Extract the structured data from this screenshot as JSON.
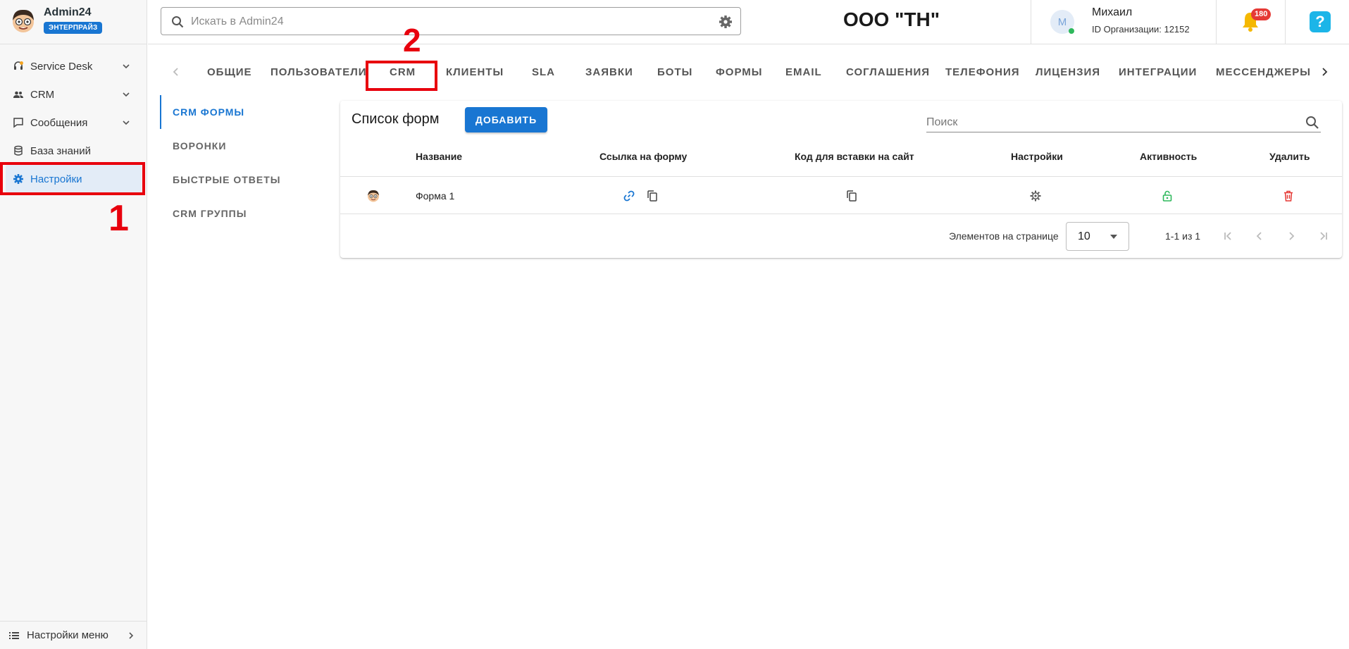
{
  "brand": {
    "name": "Admin24",
    "badge": "ЭНТЕРПРАЙЗ"
  },
  "sidebar": {
    "items": [
      {
        "label": "Service Desk",
        "icon": "headset-icon",
        "has_chevron": true
      },
      {
        "label": "CRM",
        "icon": "people-icon",
        "has_chevron": true
      },
      {
        "label": "Сообщения",
        "icon": "chat-icon",
        "has_chevron": true
      },
      {
        "label": "База знаний",
        "icon": "database-icon",
        "has_chevron": false
      },
      {
        "label": "Настройки",
        "icon": "gear-icon",
        "active": true
      }
    ],
    "menu_settings_label": "Настройки меню"
  },
  "annotations": {
    "marker_1": "1",
    "marker_2": "2"
  },
  "header": {
    "search_placeholder": "Искать в Admin24",
    "org_title": "ООО \"ТН\"",
    "user_initial": "М",
    "user_name": "Михаил",
    "org_id": "ID Организации: 12152",
    "notifications_count": "180",
    "help_label": "?"
  },
  "tabs": [
    {
      "label": "ОБЩИЕ"
    },
    {
      "label": "ПОЛЬЗОВАТЕЛИ"
    },
    {
      "label": "CRM",
      "highlighted": true
    },
    {
      "label": "КЛИЕНТЫ"
    },
    {
      "label": "SLA"
    },
    {
      "label": "ЗАЯВКИ"
    },
    {
      "label": "БОТЫ"
    },
    {
      "label": "ФОРМЫ"
    },
    {
      "label": "EMAIL"
    },
    {
      "label": "СОГЛАШЕНИЯ"
    },
    {
      "label": "ТЕЛЕФОНИЯ"
    },
    {
      "label": "ЛИЦЕНЗИЯ"
    },
    {
      "label": "ИНТЕГРАЦИИ"
    },
    {
      "label": "МЕССЕНДЖЕРЫ"
    }
  ],
  "submenu": [
    {
      "label": "CRM ФОРМЫ",
      "active": true
    },
    {
      "label": "ВОРОНКИ"
    },
    {
      "label": "БЫСТРЫЕ ОТВЕТЫ"
    },
    {
      "label": "CRM ГРУППЫ"
    }
  ],
  "card": {
    "title": "Список форм",
    "add_label": "ДОБАВИТЬ",
    "search_placeholder": "Поиск",
    "columns": [
      "Название",
      "Ссылка на форму",
      "Код для вставки на сайт",
      "Настройки",
      "Активность",
      "Удалить"
    ],
    "rows": [
      {
        "name": "Форма 1",
        "active": true
      }
    ],
    "pager": {
      "per_page_label": "Элементов на странице",
      "per_page_value": "10",
      "range": "1-1 из 1"
    }
  },
  "colors": {
    "accent": "#1976d2",
    "annotation_red": "#e8000d",
    "active_green": "#2eb85c",
    "delete_red": "#e53935",
    "badge_red": "#e53935",
    "help_blue": "#1cb5e8"
  }
}
